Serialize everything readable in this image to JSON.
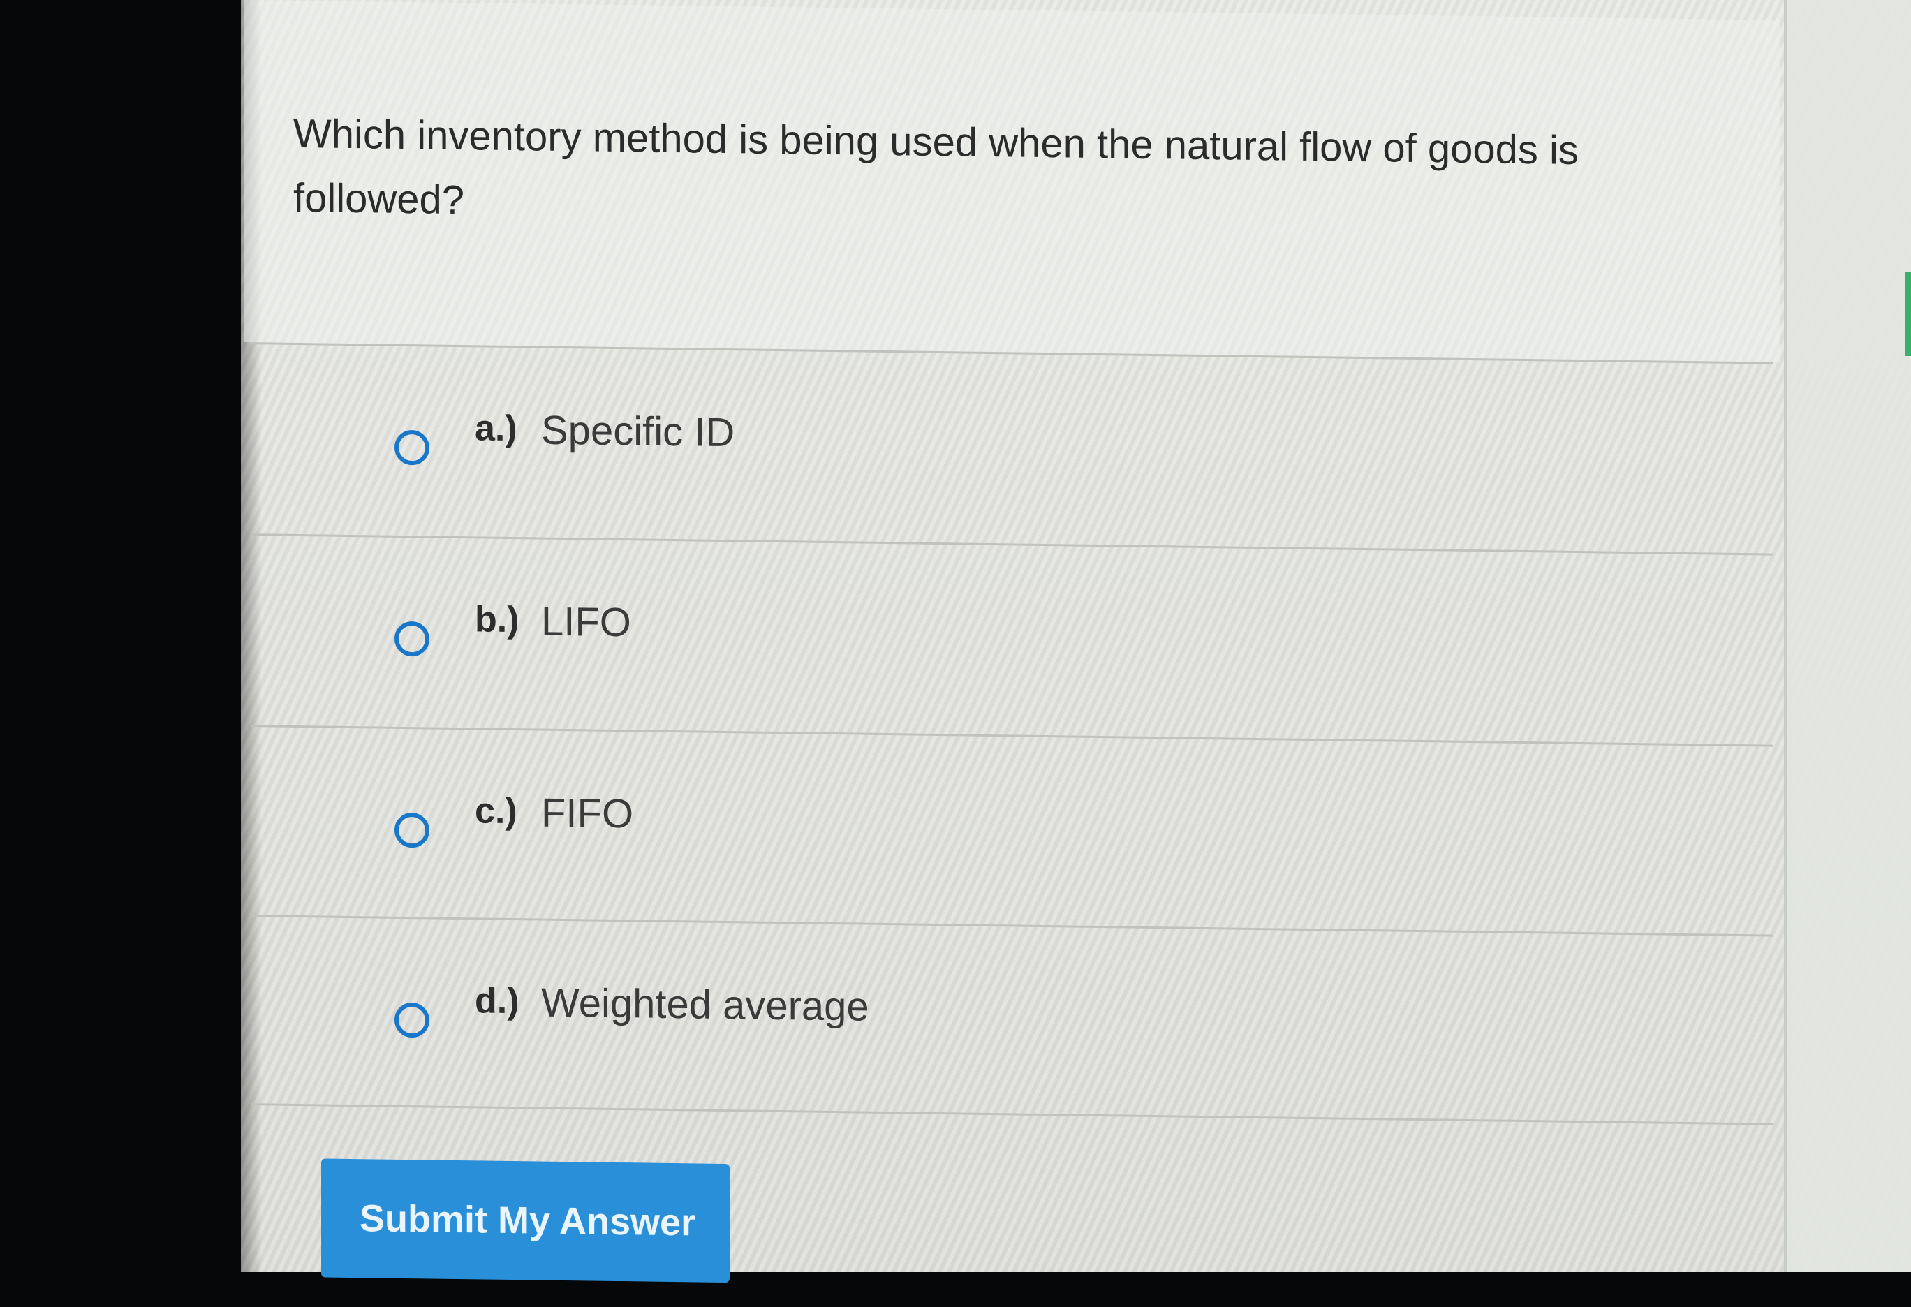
{
  "question": {
    "text": "Which inventory method is being used when the natural flow of goods is followed?"
  },
  "options": [
    {
      "letter": "a.)",
      "text": "Specific ID",
      "selected": false
    },
    {
      "letter": "b.)",
      "text": "LIFO",
      "selected": false
    },
    {
      "letter": "c.)",
      "text": "FIFO",
      "selected": false
    },
    {
      "letter": "d.)",
      "text": "Weighted average",
      "selected": false
    }
  ],
  "submit": {
    "label": "Submit My Answer"
  },
  "colors": {
    "accent": "#1877c8",
    "button": "#2a8fd9"
  }
}
